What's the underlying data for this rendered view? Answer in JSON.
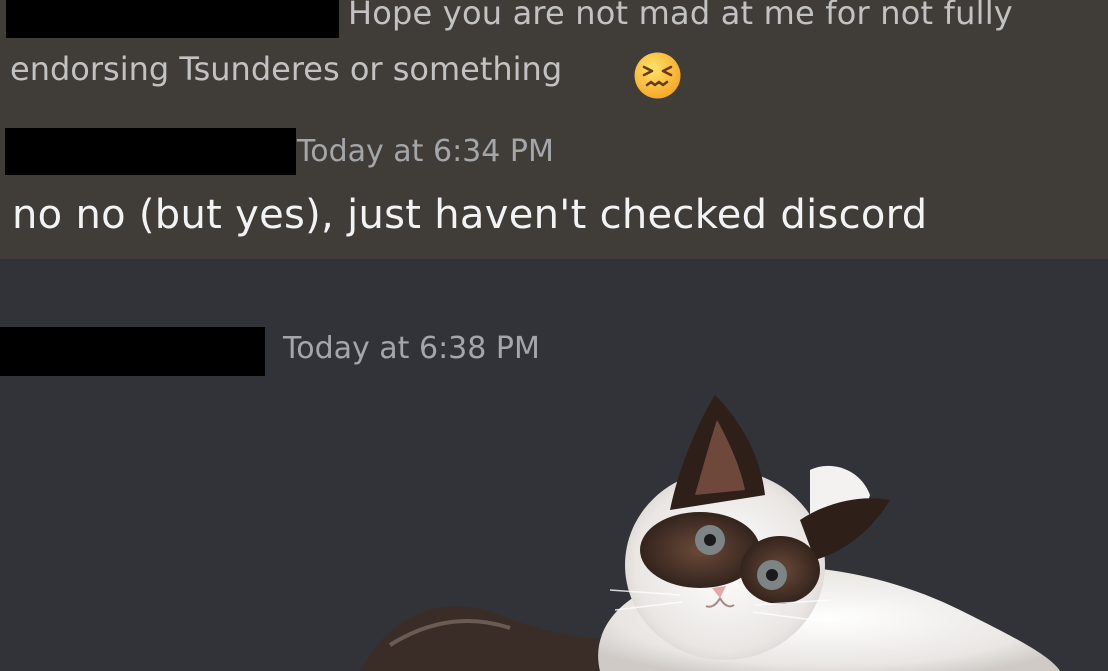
{
  "messages": [
    {
      "reply_line1": "Hope you are not mad at me for not fully",
      "reply_line2": "endorsing Tsunderes or something",
      "reply_emoji": "confounded-face-emoji"
    },
    {
      "timestamp": "Today at 6:34 PM",
      "text": "no no (but yes), just haven't checked discord"
    },
    {
      "timestamp": "Today at 6:38 PM",
      "attachment": "cat-image"
    }
  ],
  "colors": {
    "highlight_bg": "#403d38",
    "chat_bg": "#313338",
    "timestamp": "#a3a6aa",
    "message_text": "#f2f3f5",
    "reply_text": "#c2c2c2"
  }
}
